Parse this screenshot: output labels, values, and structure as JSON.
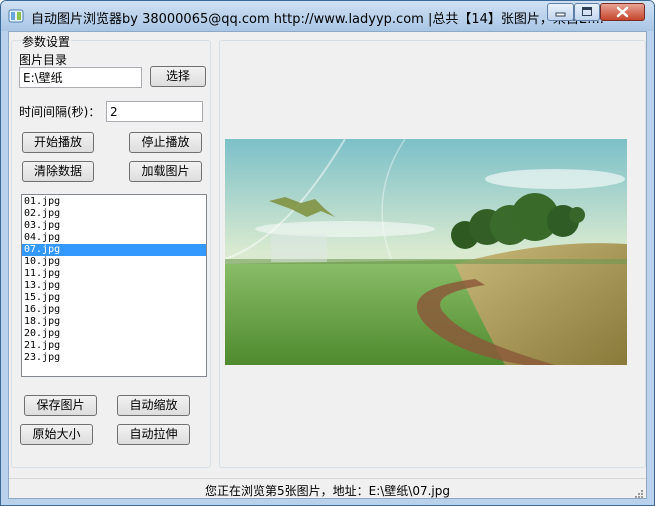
{
  "window": {
    "title": "自动图片浏览器by 38000065@qq.com http://www.ladyyp.com |总共【14】张图片，来自E:..."
  },
  "settings": {
    "group_title": "参数设置",
    "dir_label": "图片目录",
    "dir_value": "E:\\壁纸",
    "choose_label": "选择",
    "interval_label": "时间间隔(秒)：",
    "interval_value": "2"
  },
  "buttons": {
    "start": "开始播放",
    "stop": "停止播放",
    "clear": "清除数据",
    "load": "加载图片",
    "save": "保存图片",
    "auto_zoom": "自动缩放",
    "original": "原始大小",
    "auto_stretch": "自动拉伸"
  },
  "file_list": {
    "items": [
      "01.jpg",
      "02.jpg",
      "03.jpg",
      "04.jpg",
      "07.jpg",
      "10.jpg",
      "11.jpg",
      "13.jpg",
      "15.jpg",
      "16.jpg",
      "18.jpg",
      "20.jpg",
      "21.jpg",
      "23.jpg"
    ],
    "selected_index": 4
  },
  "status": {
    "text": "您正在浏览第5张图片，地址：E:\\壁纸\\07.jpg"
  },
  "colors": {
    "selection": "#3399ff",
    "close_button": "#c4452c"
  },
  "icons": [
    "app-icon",
    "minimize-icon",
    "maximize-icon",
    "close-icon",
    "size-grip-icon"
  ]
}
